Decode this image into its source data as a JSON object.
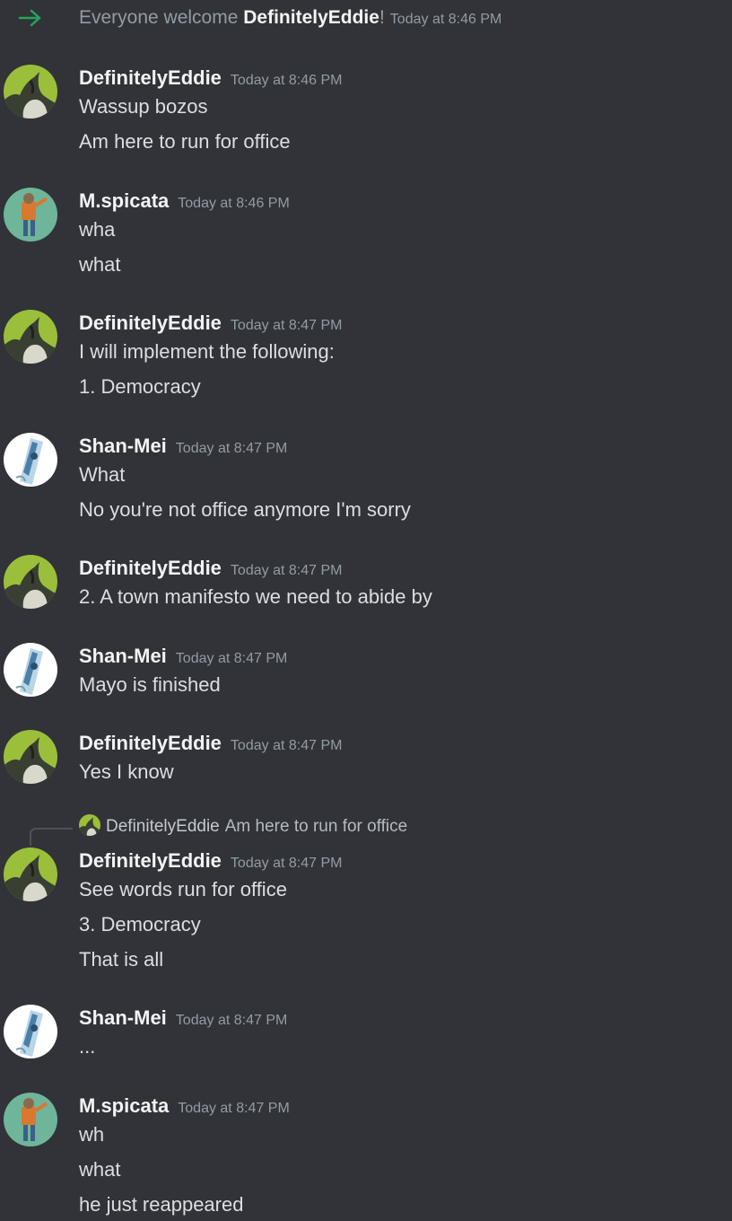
{
  "system_message": {
    "prefix": "Everyone welcome ",
    "username": "DefinitelyEddie",
    "suffix": "!",
    "timestamp": "Today at 8:46 PM"
  },
  "groups": [
    {
      "username": "DefinitelyEddie",
      "timestamp": "Today at 8:46 PM",
      "avatar_icon": "eddie-avatar",
      "lines": [
        "Wassup bozos",
        "Am here to run for office"
      ]
    },
    {
      "username": "M.spicata",
      "timestamp": "Today at 8:46 PM",
      "avatar_icon": "spicata-avatar",
      "lines": [
        "wha",
        "what"
      ]
    },
    {
      "username": "DefinitelyEddie",
      "timestamp": "Today at 8:47 PM",
      "avatar_icon": "eddie-avatar",
      "lines": [
        "I will implement the following:",
        "1. Democracy"
      ]
    },
    {
      "username": "Shan-Mei",
      "timestamp": "Today at 8:47 PM",
      "avatar_icon": "shanmei-avatar",
      "lines": [
        "What",
        "No you're not office anymore I'm sorry"
      ]
    },
    {
      "username": "DefinitelyEddie",
      "timestamp": "Today at 8:47 PM",
      "avatar_icon": "eddie-avatar",
      "lines": [
        "2. A town manifesto we need to abide by"
      ]
    },
    {
      "username": "Shan-Mei",
      "timestamp": "Today at 8:47 PM",
      "avatar_icon": "shanmei-avatar",
      "lines": [
        "Mayo is finished"
      ]
    },
    {
      "username": "DefinitelyEddie",
      "timestamp": "Today at 8:47 PM",
      "avatar_icon": "eddie-avatar",
      "lines": [
        "Yes I know"
      ]
    },
    {
      "username": "DefinitelyEddie",
      "timestamp": "Today at 8:47 PM",
      "avatar_icon": "eddie-avatar",
      "reply": {
        "username": "DefinitelyEddie",
        "text": "Am here to run for office"
      },
      "lines": [
        "See words run for office",
        "3. Democracy",
        "That is all"
      ]
    },
    {
      "username": "Shan-Mei",
      "timestamp": "Today at 8:47 PM",
      "avatar_icon": "shanmei-avatar",
      "lines": [
        "..."
      ]
    },
    {
      "username": "M.spicata",
      "timestamp": "Today at 8:47 PM",
      "avatar_icon": "spicata-avatar",
      "lines": [
        "wh",
        "what",
        "he just reappeared"
      ]
    }
  ],
  "colors": {
    "background": "#313338",
    "username": "#f2f3f5",
    "message_text": "#dbdee1",
    "timestamp": "#949ba4",
    "join_arrow": "#23a55a"
  }
}
